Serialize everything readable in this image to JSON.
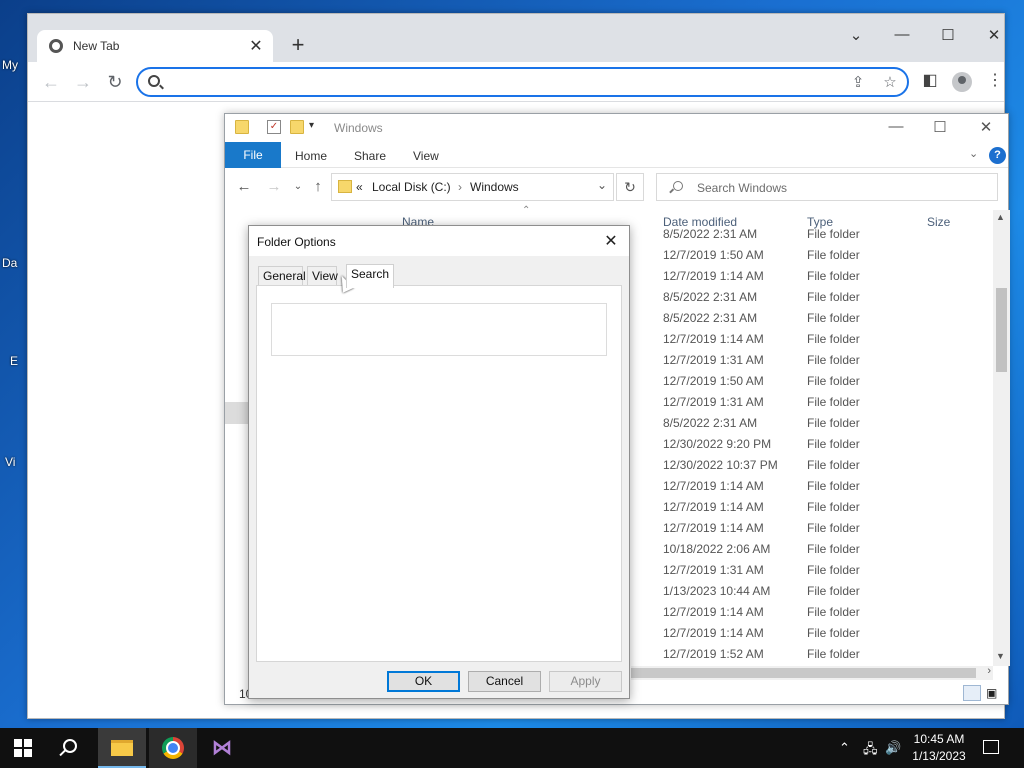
{
  "desktop": {
    "icon_labels": [
      "My",
      "Da",
      "E",
      "Vi"
    ]
  },
  "chrome": {
    "tab_title": "New Tab",
    "tab_close": "✕",
    "new_tab": "+",
    "window_controls": {
      "dropdown": "⌄",
      "minimize": "—",
      "maximize": "☐",
      "close": "✕"
    },
    "nav": {
      "back": "←",
      "forward": "→",
      "reload": "↻"
    },
    "omnibox_value": "",
    "omnibox_icons": [
      "share-icon",
      "star-icon"
    ],
    "share": "⇪",
    "star": "☆",
    "side_panel": "◧",
    "menu": "⋮"
  },
  "explorer": {
    "title": "Windows",
    "window_controls": {
      "minimize": "—",
      "maximize": "☐",
      "close": "✕"
    },
    "ribbon": {
      "file": "File",
      "tabs": [
        "Home",
        "Share",
        "View"
      ],
      "help": "?"
    },
    "address": {
      "overflow": "«",
      "crumbs": [
        "Local Disk (C:)",
        "Windows"
      ],
      "sep": "›"
    },
    "search_placeholder": "Search Windows",
    "columns": {
      "name": "Name",
      "date": "Date modified",
      "type": "Type",
      "size": "Size"
    },
    "rows": [
      {
        "date": "8/5/2022 2:31 AM",
        "type": "File folder"
      },
      {
        "date": "12/7/2019 1:50 AM",
        "type": "File folder"
      },
      {
        "date": "12/7/2019 1:14 AM",
        "type": "File folder"
      },
      {
        "date": "8/5/2022 2:31 AM",
        "type": "File folder"
      },
      {
        "date": "8/5/2022 2:31 AM",
        "type": "File folder"
      },
      {
        "date": "12/7/2019 1:14 AM",
        "type": "File folder"
      },
      {
        "date": "12/7/2019 1:31 AM",
        "type": "File folder"
      },
      {
        "date": "12/7/2019 1:50 AM",
        "type": "File folder"
      },
      {
        "date": "12/7/2019 1:31 AM",
        "type": "File folder"
      },
      {
        "date": "8/5/2022 2:31 AM",
        "type": "File folder"
      },
      {
        "date": "12/30/2022 9:20 PM",
        "type": "File folder"
      },
      {
        "date": "12/30/2022 10:37 PM",
        "type": "File folder"
      },
      {
        "date": "12/7/2019 1:14 AM",
        "type": "File folder"
      },
      {
        "date": "12/7/2019 1:14 AM",
        "type": "File folder"
      },
      {
        "date": "12/7/2019 1:14 AM",
        "type": "File folder"
      },
      {
        "date": "10/18/2022 2:06 AM",
        "type": "File folder"
      },
      {
        "date": "12/7/2019 1:31 AM",
        "type": "File folder"
      },
      {
        "date": "1/13/2023 10:44 AM",
        "type": "File folder"
      },
      {
        "date": "12/7/2019 1:14 AM",
        "type": "File folder"
      },
      {
        "date": "12/7/2019 1:14 AM",
        "type": "File folder"
      },
      {
        "date": "12/7/2019 1:52 AM",
        "type": "File folder"
      }
    ],
    "status_count": "10"
  },
  "dialog": {
    "title": "Folder Options",
    "close": "✕",
    "tabs": [
      "General",
      "View",
      "Search"
    ],
    "active_tab": "Search",
    "buttons": {
      "ok": "OK",
      "cancel": "Cancel",
      "apply": "Apply"
    }
  },
  "taskbar": {
    "time": "10:45 AM",
    "date": "1/13/2023",
    "apps": [
      "file-explorer",
      "chrome",
      "visual-studio"
    ],
    "tray_icons": [
      "chevron-up-icon",
      "network-icon",
      "volume-icon",
      "notification-icon"
    ]
  }
}
